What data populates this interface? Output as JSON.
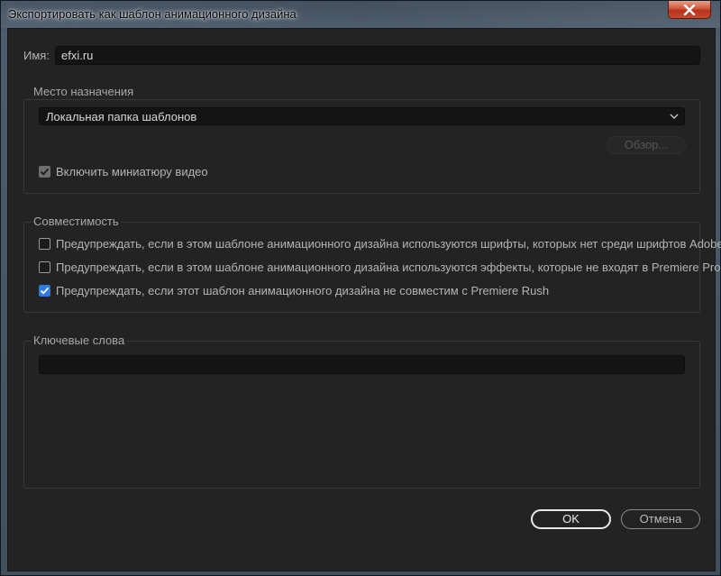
{
  "window": {
    "title": "Экспортировать как шаблон анимационного дизайна",
    "close_icon": "close-icon"
  },
  "name_field": {
    "label": "Имя:",
    "value": "efxi.ru"
  },
  "destination": {
    "group_title": "Место назначения",
    "selected": "Локальная папка шаблонов",
    "browse_label": "Обзор...",
    "include_thumbnail_label": "Включить миниатюру видео",
    "include_thumbnail_checked": true
  },
  "compatibility": {
    "group_title": "Совместимость",
    "options": [
      {
        "label": "Предупреждать, если в этом шаблоне анимационного дизайна используются шрифты, которых нет среди шрифтов Adobe",
        "checked": false
      },
      {
        "label": "Предупреждать, если в этом шаблоне анимационного дизайна используются эффекты, которые не входят в Premiere Pro",
        "checked": false
      },
      {
        "label": "Предупреждать, если этот шаблон анимационного дизайна не совместим с Premiere Rush",
        "checked": true
      }
    ]
  },
  "keywords": {
    "group_title": "Ключевые слова",
    "value": ""
  },
  "buttons": {
    "ok_label": "OK",
    "cancel_label": "Отмена"
  },
  "colors": {
    "dialog_bg": "#232323",
    "field_bg": "#141414",
    "checkbox_accent": "#2d7be0",
    "close_button": "#c94a2c"
  }
}
